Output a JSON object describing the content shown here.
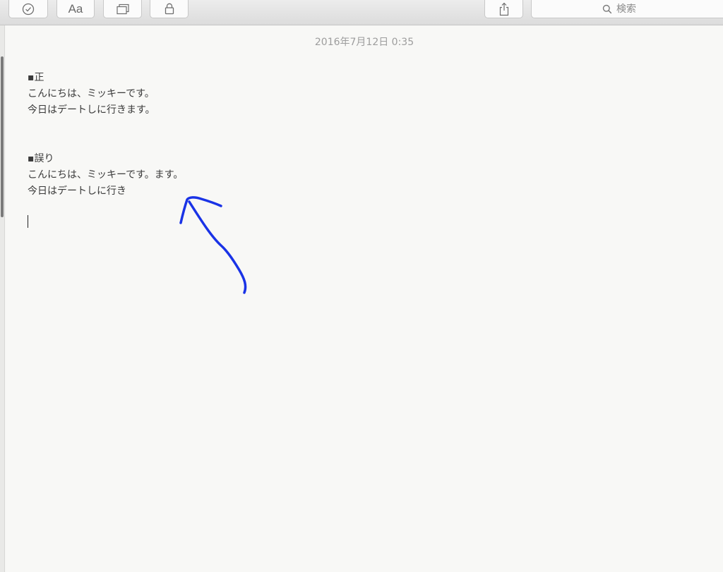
{
  "toolbar": {
    "buttons": [
      {
        "name": "checklist",
        "icon": "checkmark-circle-icon"
      },
      {
        "name": "format",
        "icon": "font-icon",
        "label": "Aa"
      },
      {
        "name": "attachments",
        "icon": "window-icon"
      },
      {
        "name": "lock",
        "icon": "lock-icon"
      },
      {
        "name": "share",
        "icon": "share-icon"
      }
    ],
    "search_placeholder": "検索"
  },
  "note": {
    "timestamp": "2016年7月12日 0:35",
    "lines": [
      "▪正",
      "こんにちは、ミッキーです。",
      "今日はデートしに行きます。",
      "",
      "",
      "▪誤り",
      "こんにちは、ミッキーです。ます。",
      "今日はデートしに行き"
    ]
  },
  "annotation": {
    "shape": "hand-drawn-arrow",
    "color": "#1a33e6"
  }
}
